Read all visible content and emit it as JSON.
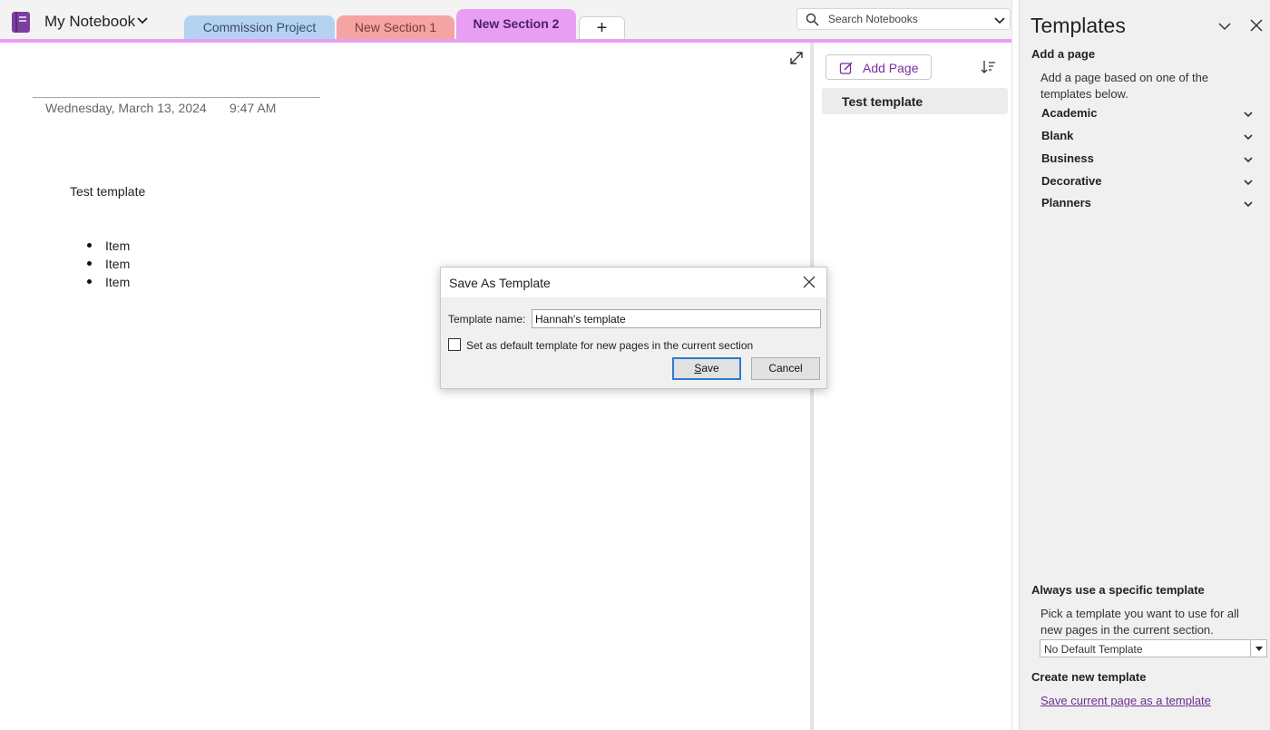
{
  "notebook": {
    "name": "My Notebook"
  },
  "tabs": [
    {
      "label": "Commission Project"
    },
    {
      "label": "New Section 1"
    },
    {
      "label": "New Section 2"
    }
  ],
  "add_tab_label": "+",
  "search": {
    "placeholder": "Search Notebooks"
  },
  "page": {
    "date": "Wednesday, March 13, 2024",
    "time": "9:47 AM",
    "body_title": "Test template",
    "bullets": [
      "Item",
      "Item",
      "Item"
    ]
  },
  "pages_pane": {
    "add_page_label": "Add Page",
    "items": [
      {
        "label": "Test template"
      }
    ]
  },
  "templates_panel": {
    "title": "Templates",
    "add_page_heading": "Add a page",
    "add_page_desc": "Add a page based on one of the templates below.",
    "categories": [
      "Academic",
      "Blank",
      "Business",
      "Decorative",
      "Planners"
    ],
    "always_heading": "Always use a specific template",
    "always_desc": "Pick a template you want to use for all new pages in the current section.",
    "default_select": "No Default Template",
    "create_heading": "Create new template",
    "create_link": "Save current page as a template"
  },
  "dialog": {
    "title": "Save As Template",
    "name_label": "Template name:",
    "name_value": "Hannah's template",
    "default_checkbox_label": "Set as default template for new pages in the current section",
    "default_checked": false,
    "save_label": "ave",
    "save_mnemonic": "S",
    "cancel_label": "Cancel"
  },
  "colors": {
    "accent": "#e89ef2",
    "tab_blue": "#b4d3f3",
    "tab_red": "#f5a3a3",
    "link_purple": "#6b2f8f"
  }
}
